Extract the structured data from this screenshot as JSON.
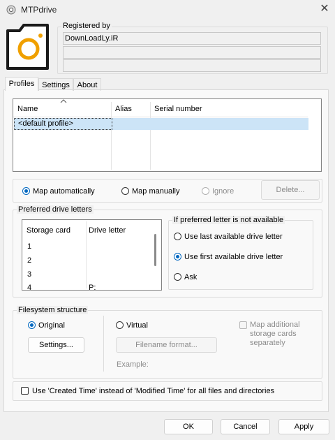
{
  "window": {
    "title": "MTPdrive",
    "close_glyph": "✕"
  },
  "registration": {
    "label": "Registered by",
    "line1": "DownLoadLy.iR",
    "line2": "",
    "line3": ""
  },
  "tabs": [
    {
      "label": "Profiles"
    },
    {
      "label": "Settings"
    },
    {
      "label": "About"
    }
  ],
  "profiles_table": {
    "columns": [
      "Name",
      "Alias",
      "Serial number"
    ],
    "rows": [
      {
        "name": "<default profile>",
        "alias": "",
        "serial": ""
      }
    ]
  },
  "mapping": {
    "auto": "Map automatically",
    "manual": "Map manually",
    "ignore": "Ignore",
    "delete": "Delete..."
  },
  "preferred": {
    "group_label": "Preferred drive letters",
    "columns": [
      "Storage card",
      "Drive letter"
    ],
    "rows": [
      {
        "card": "1",
        "letter": ""
      },
      {
        "card": "2",
        "letter": ""
      },
      {
        "card": "3",
        "letter": ""
      },
      {
        "card": "4",
        "letter": "P:"
      }
    ],
    "fallback_label": "If preferred letter is not available",
    "opt_last": "Use last available drive letter",
    "opt_first": "Use first available drive letter",
    "opt_ask": "Ask"
  },
  "filesystem": {
    "group_label": "Filesystem structure",
    "original": "Original",
    "settings_btn": "Settings...",
    "virtual": "Virtual",
    "filename_btn": "Filename format...",
    "example": "Example:",
    "map_additional": "Map additional storage cards separately"
  },
  "created_time": "Use 'Created Time' instead of 'Modified Time' for all files and directories",
  "footer": {
    "ok": "OK",
    "cancel": "Cancel",
    "apply": "Apply"
  },
  "colors": {
    "accent": "#0067c0",
    "logo_orange": "#f0a000",
    "selection": "#cce4f7"
  }
}
